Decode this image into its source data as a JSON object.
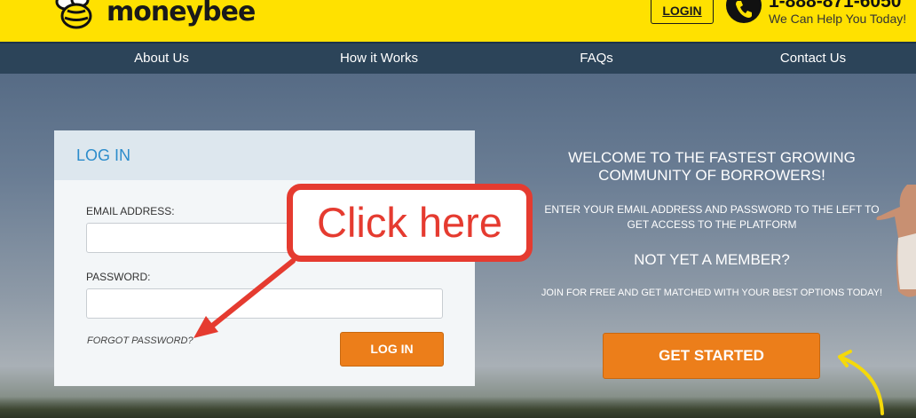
{
  "header": {
    "brand": "moneybee",
    "login_label": "LOGIN",
    "phone": "1-888-871-6050",
    "help_text": "We Can Help You Today!"
  },
  "nav": {
    "items": [
      "About Us",
      "How it Works",
      "FAQs",
      "Contact Us"
    ]
  },
  "login_card": {
    "title": "LOG IN",
    "email_label": "EMAIL ADDRESS:",
    "email_value": "",
    "password_label": "PASSWORD:",
    "password_value": "",
    "forgot_label": "FORGOT PASSWORD?",
    "submit_label": "LOG IN"
  },
  "signup": {
    "welcome": "WELCOME TO THE FASTEST GROWING COMMUNITY OF BORROWERS!",
    "instructions": "ENTER YOUR EMAIL ADDRESS AND PASSWORD TO THE LEFT TO GET ACCESS TO THE PLATFORM",
    "not_member": "NOT YET A MEMBER?",
    "join_text": "JOIN FOR FREE AND GET MATCHED WITH YOUR BEST OPTIONS TODAY!",
    "cta_label": "GET STARTED"
  },
  "annotation": {
    "callout_text": "Click here"
  },
  "colors": {
    "header_bg": "#ffe100",
    "nav_bg": "#2c4459",
    "accent_orange": "#ec7e1a",
    "link_blue": "#2c8ccb",
    "annotation_red": "#e53b30",
    "arrow_yellow": "#f5d90a"
  },
  "icons": [
    "bee-logo-icon",
    "phone-icon",
    "red-arrow-icon",
    "yellow-curved-arrow-icon"
  ]
}
